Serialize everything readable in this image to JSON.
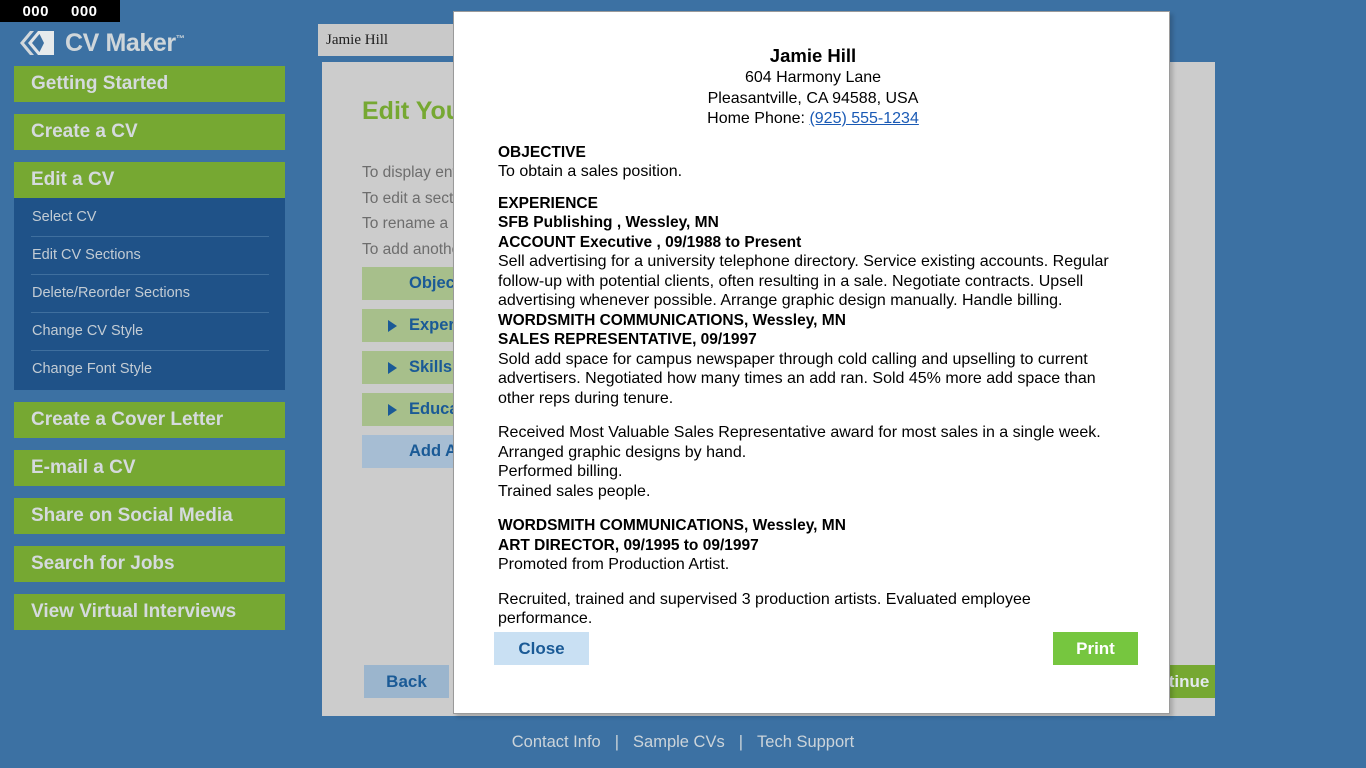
{
  "counter": {
    "left": "000",
    "right": "000"
  },
  "brand": {
    "name": "CV Maker",
    "tm": "™"
  },
  "sidebar": {
    "items": [
      {
        "label": "Getting Started"
      },
      {
        "label": "Create a CV"
      },
      {
        "label": "Edit a CV"
      },
      {
        "label": "Create a Cover Letter"
      },
      {
        "label": "E-mail a CV"
      },
      {
        "label": "Share on Social Media"
      },
      {
        "label": "Search for Jobs"
      },
      {
        "label": "View Virtual Interviews"
      }
    ],
    "submenu": [
      {
        "label": "Select CV"
      },
      {
        "label": "Edit CV Sections"
      },
      {
        "label": "Delete/Reorder Sections"
      },
      {
        "label": "Change CV Style"
      },
      {
        "label": "Change Font Style"
      }
    ]
  },
  "breadcrumb": {
    "text": "Jamie Hill"
  },
  "main": {
    "title": "Edit Your CV",
    "instructions": [
      "To display entire CV, click Preview CV.",
      "To edit a section, click the section name.",
      "To rename a section, click Rename.",
      "To add another section, click Add Another Section."
    ],
    "sections": [
      {
        "label": "Objective"
      },
      {
        "label": "Experience"
      },
      {
        "label": "Skills"
      },
      {
        "label": "Education"
      }
    ],
    "add_section_label": "Add Another Section",
    "back_label": "Back",
    "continue_label": "Continue"
  },
  "footer": {
    "links": [
      "Contact Info",
      "Sample CVs",
      "Tech Support"
    ],
    "separator": "|"
  },
  "modal": {
    "close_label": "Close",
    "print_label": "Print",
    "cv": {
      "name": "Jamie Hill",
      "address_line1": "604 Harmony Lane",
      "address_line2": "Pleasantville, CA 94588, USA",
      "phone_label": "Home Phone:",
      "phone": "(925) 555-1234",
      "objective_heading": "OBJECTIVE",
      "objective_text": "To obtain a sales position.",
      "experience_heading": "EXPERIENCE",
      "jobs": [
        {
          "company": "SFB Publishing , Wessley, MN",
          "title": "ACCOUNT Executive , 09/1988 to Present",
          "description": "Sell advertising for a university telephone directory. Service existing accounts. Regular follow-up with potential clients, often resulting in a sale. Negotiate contracts. Upsell advertising whenever possible. Arrange graphic design manually. Handle billing."
        },
        {
          "company": "WORDSMITH COMMUNICATIONS, Wessley, MN",
          "title": "SALES REPRESENTATIVE, 09/1997",
          "description": "Sold add space for campus newspaper through cold calling and upselling to current advertisers. Negotiated how many times an add ran. Sold 45% more add space than other reps during tenure."
        }
      ],
      "achievements": [
        "Received Most Valuable Sales Representative award for most sales in a single week.",
        "Arranged graphic designs by hand.",
        "Performed billing.",
        "Trained sales people."
      ],
      "job3": {
        "company": "WORDSMITH COMMUNICATIONS, Wessley, MN",
        "title": "ART DIRECTOR, 09/1995 to 09/1997",
        "description": "Promoted from Production Artist.",
        "description2": "Recruited, trained and supervised 3 production artists. Evaluated employee performance."
      }
    }
  },
  "colors": {
    "page_blue": "#3c71a3",
    "nav_green": "#76a832",
    "submenu_navy": "#1f5288",
    "panel_gray": "#cccccc",
    "link_blue": "#1a5a96",
    "print_green": "#76c63f"
  }
}
